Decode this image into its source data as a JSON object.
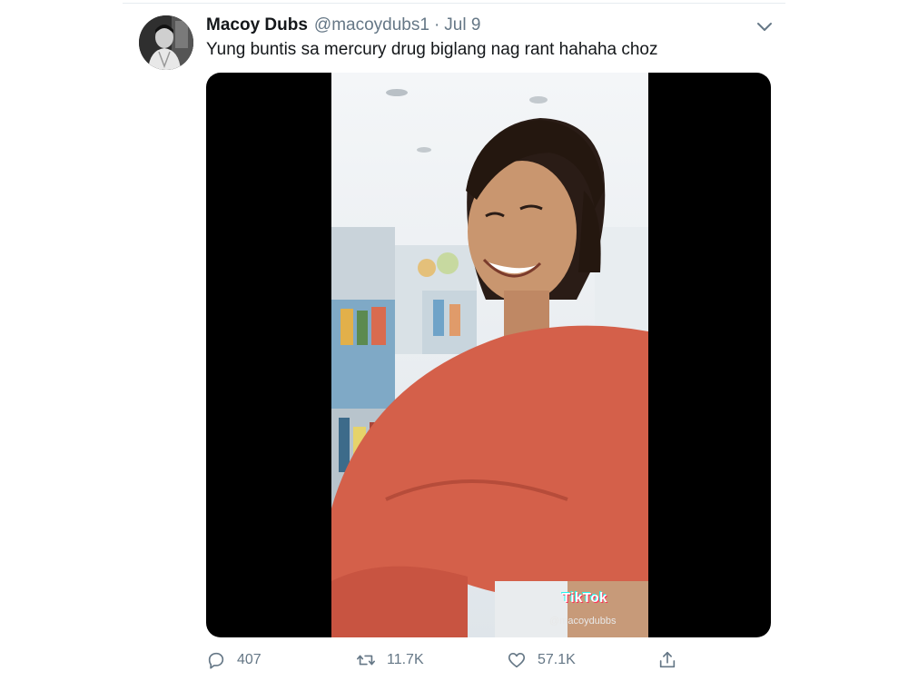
{
  "tweet": {
    "author_name": "Macoy Dubs",
    "author_handle": "@macoydubs1",
    "separator": "·",
    "date": "Jul 9",
    "text": "Yung buntis sa mercury drug biglang nag rant hahaha choz"
  },
  "media": {
    "watermark_logo": "TikTok",
    "watermark_user": "@macoydubbs"
  },
  "actions": {
    "reply_count": "407",
    "retweet_count": "11.7K",
    "like_count": "57.1K"
  },
  "icons": {
    "menu": "chevron-down-icon",
    "reply": "reply-icon",
    "retweet": "retweet-icon",
    "like": "heart-icon",
    "share": "share-icon"
  },
  "colors": {
    "text": "#14171a",
    "secondary": "#657786",
    "shirt": "#d4604a"
  }
}
